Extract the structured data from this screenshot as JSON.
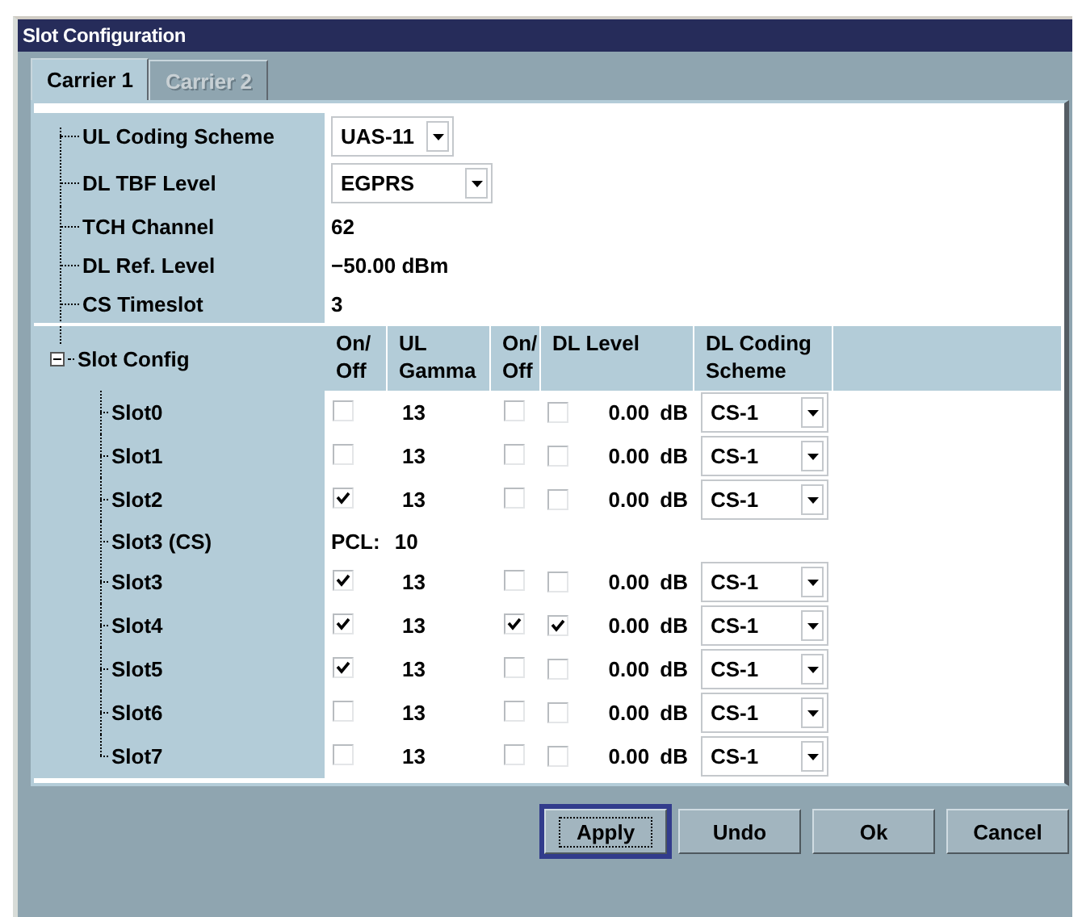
{
  "window": {
    "title": "Slot Configuration"
  },
  "tabs": [
    {
      "label": "Carrier 1",
      "selected": true
    },
    {
      "label": "Carrier 2",
      "selected": false
    }
  ],
  "settings": [
    {
      "label": "UL Coding Scheme",
      "kind": "dropdown",
      "value": "UAS-11"
    },
    {
      "label": "DL TBF Level",
      "kind": "dropdown",
      "value": "EGPRS"
    },
    {
      "label": "TCH Channel",
      "kind": "text",
      "value": "62"
    },
    {
      "label": "DL Ref. Level",
      "kind": "text",
      "value": "−50.00 dBm"
    },
    {
      "label": "CS Timeslot",
      "kind": "text",
      "value": "3"
    }
  ],
  "slot_config": {
    "label": "Slot Config",
    "expanded": true,
    "columns": [
      "On/ Off",
      "UL Gamma",
      "On/ Off",
      "DL Level",
      "DL Coding Scheme"
    ],
    "slots": [
      {
        "label": "Slot0",
        "kind": "slot",
        "ul_on": false,
        "ul_gamma": "13",
        "dl_on": false,
        "level_on": false,
        "dl_level": "0.00 dB",
        "dl_coding": "CS-1"
      },
      {
        "label": "Slot1",
        "kind": "slot",
        "ul_on": false,
        "ul_gamma": "13",
        "dl_on": false,
        "level_on": false,
        "dl_level": "0.00 dB",
        "dl_coding": "CS-1"
      },
      {
        "label": "Slot2",
        "kind": "slot",
        "ul_on": true,
        "ul_gamma": "13",
        "dl_on": false,
        "level_on": false,
        "dl_level": "0.00 dB",
        "dl_coding": "CS-1"
      },
      {
        "label": "Slot3 (CS)",
        "kind": "pcl",
        "pcl_label": "PCL:",
        "pcl_value": "10"
      },
      {
        "label": "Slot3",
        "kind": "slot",
        "ul_on": true,
        "ul_gamma": "13",
        "dl_on": false,
        "level_on": false,
        "dl_level": "0.00 dB",
        "dl_coding": "CS-1"
      },
      {
        "label": "Slot4",
        "kind": "slot",
        "ul_on": true,
        "ul_gamma": "13",
        "dl_on": true,
        "level_on": true,
        "dl_level": "0.00 dB",
        "dl_coding": "CS-1"
      },
      {
        "label": "Slot5",
        "kind": "slot",
        "ul_on": true,
        "ul_gamma": "13",
        "dl_on": false,
        "level_on": false,
        "dl_level": "0.00 dB",
        "dl_coding": "CS-1"
      },
      {
        "label": "Slot6",
        "kind": "slot",
        "ul_on": false,
        "ul_gamma": "13",
        "dl_on": false,
        "level_on": false,
        "dl_level": "0.00 dB",
        "dl_coding": "CS-1"
      },
      {
        "label": "Slot7",
        "kind": "slot",
        "ul_on": false,
        "ul_gamma": "13",
        "dl_on": false,
        "level_on": false,
        "dl_level": "0.00 dB",
        "dl_coding": "CS-1"
      }
    ]
  },
  "buttons": [
    {
      "label": "Apply",
      "focused": true
    },
    {
      "label": "Undo",
      "focused": false
    },
    {
      "label": "Ok",
      "focused": false
    },
    {
      "label": "Cancel",
      "focused": false
    }
  ]
}
